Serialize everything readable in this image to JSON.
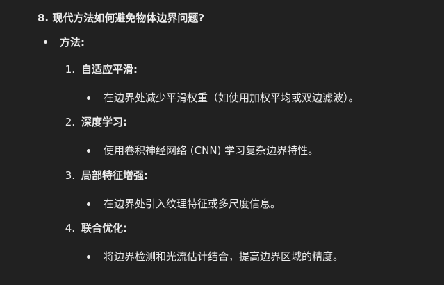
{
  "heading": "8. 现代方法如何避免物体边界问题?",
  "section": {
    "label": "方法:",
    "items": [
      {
        "number": "1.",
        "title": "自适应平滑:",
        "detail": "在边界处减少平滑权重（如使用加权平均或双边滤波）。"
      },
      {
        "number": "2.",
        "title": "深度学习:",
        "detail": "使用卷积神经网络 (CNN) 学习复杂边界特性。"
      },
      {
        "number": "3.",
        "title": "局部特征增强:",
        "detail": "在边界处引入纹理特征或多尺度信息。"
      },
      {
        "number": "4.",
        "title": "联合优化:",
        "detail": "将边界检测和光流估计结合，提高边界区域的精度。"
      }
    ]
  }
}
